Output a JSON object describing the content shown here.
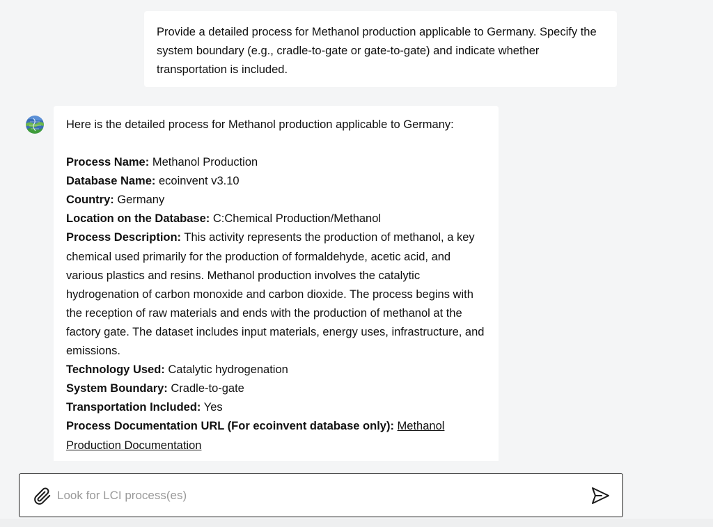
{
  "conversation": {
    "user_message": "Provide a detailed process for Methanol production applicable to Germany. Specify the system boundary (e.g., cradle-to-gate or gate-to-gate) and indicate whether transportation is included.",
    "bot": {
      "avatar_icon": "globe-avatar-icon",
      "intro": "Here is the detailed process for Methanol production applicable to Germany:",
      "fields": [
        {
          "label": "Process Name:",
          "value": "Methanol Production"
        },
        {
          "label": "Database Name:",
          "value": "ecoinvent v3.10"
        },
        {
          "label": "Country:",
          "value": "Germany"
        },
        {
          "label": "Location on the Database:",
          "value": "C:Chemical Production/Methanol"
        },
        {
          "label": "Process Description:",
          "value": "This activity represents the production of methanol, a key chemical used primarily for the production of formaldehyde, acetic acid, and various plastics and resins. Methanol production involves the catalytic hydrogenation of carbon monoxide and carbon dioxide. The process begins with the reception of raw materials and ends with the production of methanol at the factory gate. The dataset includes input materials, energy uses, infrastructure, and emissions."
        },
        {
          "label": "Technology Used:",
          "value": "Catalytic hydrogenation"
        },
        {
          "label": "System Boundary:",
          "value": "Cradle-to-gate"
        },
        {
          "label": "Transportation Included:",
          "value": "Yes"
        },
        {
          "label": "Process Documentation URL (For ecoinvent database only):",
          "link": "Methanol Production Documentation"
        }
      ]
    }
  },
  "composer": {
    "placeholder": "Look for LCI process(es)",
    "value": "",
    "attach_icon": "paperclip-icon",
    "send_icon": "send-icon"
  }
}
